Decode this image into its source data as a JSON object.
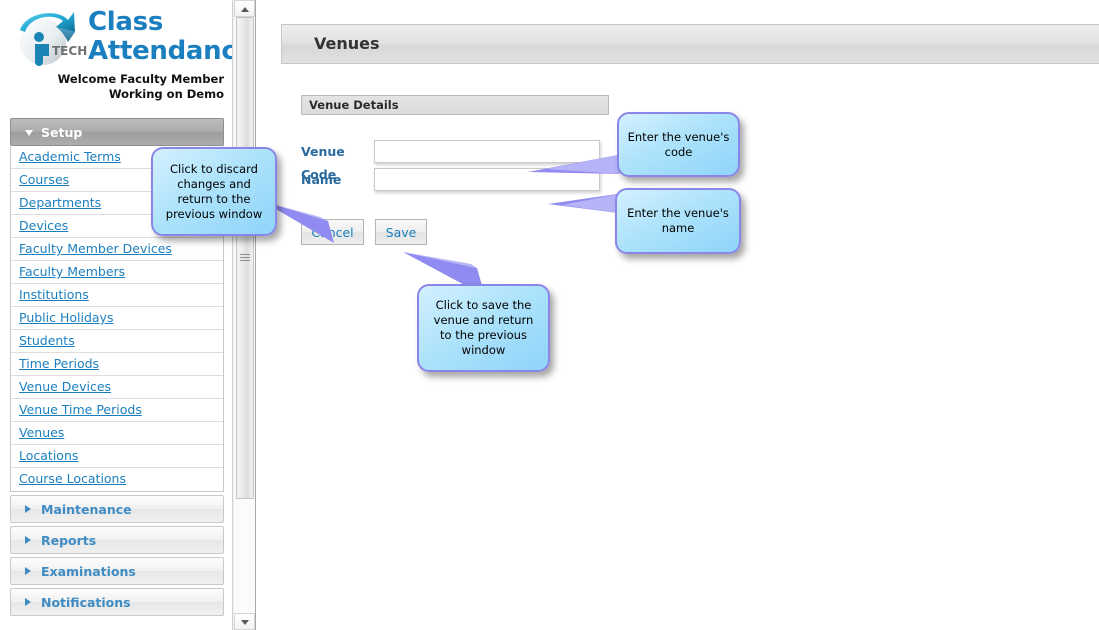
{
  "brand": {
    "logo_icon": "globe-arrow-logo",
    "title_line1": "Class",
    "title_line2": "Attendance",
    "welcome_line1": "Welcome Faculty Member",
    "welcome_line2": "Working on Demo",
    "accent_color": "#1b7fbf"
  },
  "sidebar": {
    "groups": [
      {
        "label": "Setup",
        "expanded": true,
        "icon": "chevron-down-icon"
      },
      {
        "label": "Maintenance",
        "expanded": false,
        "icon": "chevron-right-icon"
      },
      {
        "label": "Reports",
        "expanded": false,
        "icon": "chevron-right-icon"
      },
      {
        "label": "Examinations",
        "expanded": false,
        "icon": "chevron-right-icon"
      },
      {
        "label": "Notifications",
        "expanded": false,
        "icon": "chevron-right-icon"
      }
    ],
    "setup_items": [
      {
        "label": "Academic Terms"
      },
      {
        "label": "Courses"
      },
      {
        "label": "Departments"
      },
      {
        "label": "Devices"
      },
      {
        "label": "Faculty Member Devices"
      },
      {
        "label": "Faculty Members"
      },
      {
        "label": "Institutions"
      },
      {
        "label": "Public Holidays"
      },
      {
        "label": "Students"
      },
      {
        "label": "Time Periods"
      },
      {
        "label": "Venue Devices"
      },
      {
        "label": "Venue Time Periods"
      },
      {
        "label": "Venues"
      },
      {
        "label": "Locations"
      },
      {
        "label": "Course Locations"
      }
    ]
  },
  "scrollbar": {
    "up_icon": "scroll-up-arrow-icon",
    "down_icon": "scroll-down-arrow-icon",
    "grip_icon": "scrollbar-grip-icon"
  },
  "main": {
    "page_title": "Venues",
    "section_title": "Venue Details",
    "fields": [
      {
        "label": "Venue Code",
        "value": "",
        "placeholder": ""
      },
      {
        "label": "Name",
        "value": "",
        "placeholder": ""
      }
    ],
    "buttons": {
      "cancel_label": "Cancel",
      "save_label": "Save"
    }
  },
  "callouts": [
    {
      "id": "cancel",
      "text": "Click to discard changes and return to the previous window"
    },
    {
      "id": "code",
      "text": "Enter the venue's code"
    },
    {
      "id": "name",
      "text": "Enter the venue's name"
    },
    {
      "id": "save",
      "text": "Click to save the venue and return to the previous window"
    }
  ]
}
